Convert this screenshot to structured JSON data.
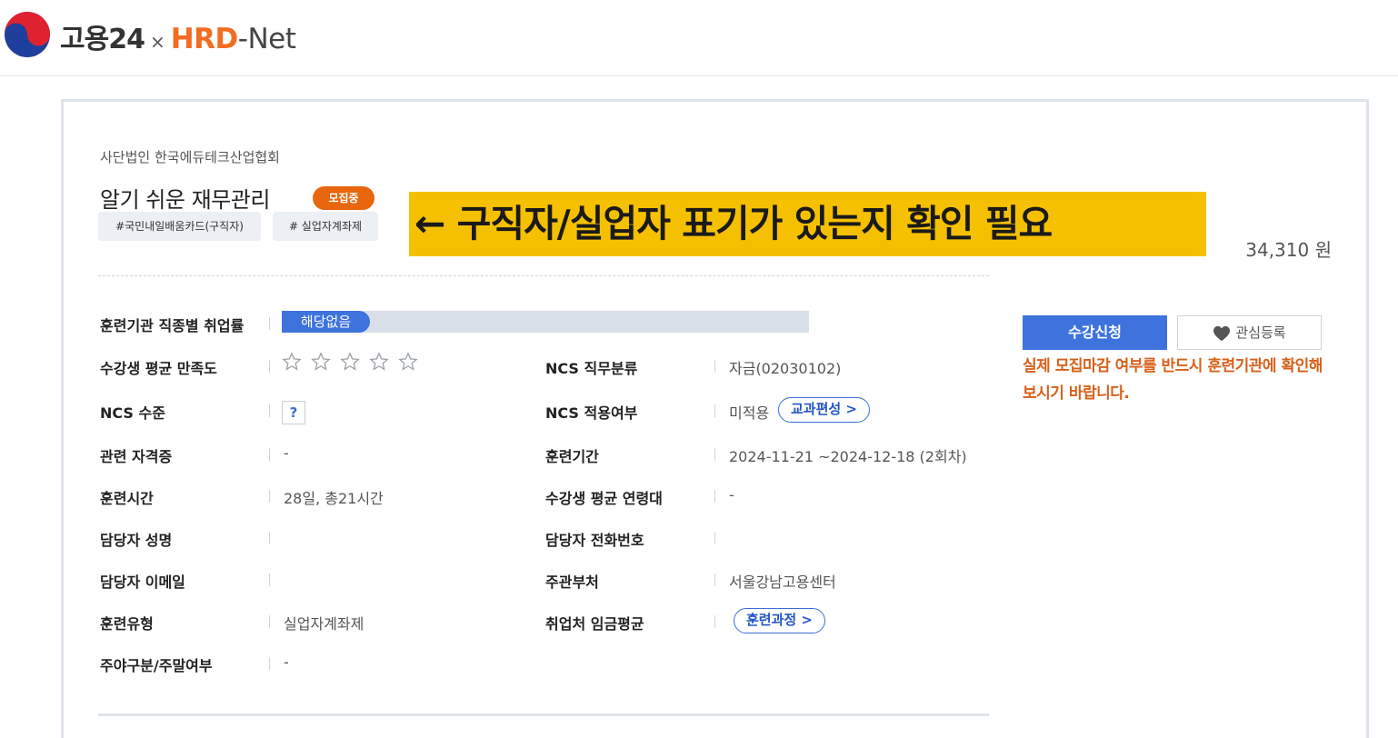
{
  "header": {
    "brand_main": "고용24",
    "brand_sep": "×",
    "brand_hrd": "HRD",
    "brand_net": "-Net"
  },
  "course": {
    "org": "사단법인 한국에듀테크산업협회",
    "title": "알기 쉬운 재무관리",
    "status": "모집중",
    "tags": [
      "#국민내일배움카드(구직자)",
      "# 실업자계좌제"
    ],
    "price": "34,310 원"
  },
  "annotation": "← 구직자/실업자 표기가 있는지 확인 필요",
  "info": {
    "employment_rate_label": "훈련기관 직종별 취업률",
    "employment_rate_value": "해당없음",
    "satisfaction_label": "수강생 평균 만족도",
    "satisfaction_stars": 0,
    "ncs_level_label": "NCS 수준",
    "ncs_level_help": "?",
    "cert_label": "관련 자격증",
    "cert_value": "-",
    "hours_label": "훈련시간",
    "hours_value": "28일, 총21시간",
    "manager_name_label": "담당자 성명",
    "manager_name_value": "",
    "manager_email_label": "담당자 이메일",
    "manager_email_value": "",
    "type_label": "훈련유형",
    "type_value": "실업자계좌제",
    "daynight_label": "주야구분/주말여부",
    "daynight_value": "-",
    "ncs_class_label": "NCS 직무분류",
    "ncs_class_value": "자금(02030102)",
    "ncs_apply_label": "NCS 적용여부",
    "ncs_apply_value": "미적용",
    "ncs_apply_button": "교과편성 >",
    "period_label": "훈련기간",
    "period_value": "2024-11-21 ~2024-12-18 (2회차)",
    "age_label": "수강생 평균 연령대",
    "age_value": "-",
    "manager_phone_label": "담당자 전화번호",
    "manager_phone_value": "",
    "dept_label": "주관부처",
    "dept_value": "서울강남고용센터",
    "wage_label": "취업처 임금평균",
    "wage_button": "훈련과정 >"
  },
  "actions": {
    "apply": "수강신청",
    "interest": "관심등록",
    "notice": "실제 모집마감 여부를 반드시 훈련기관에 확인해보시기 바랍니다."
  },
  "colors": {
    "accent_blue": "#3e73de",
    "badge_orange": "#e8660d",
    "notice_orange": "#d9601a",
    "annotation_yellow": "#f5c000"
  }
}
